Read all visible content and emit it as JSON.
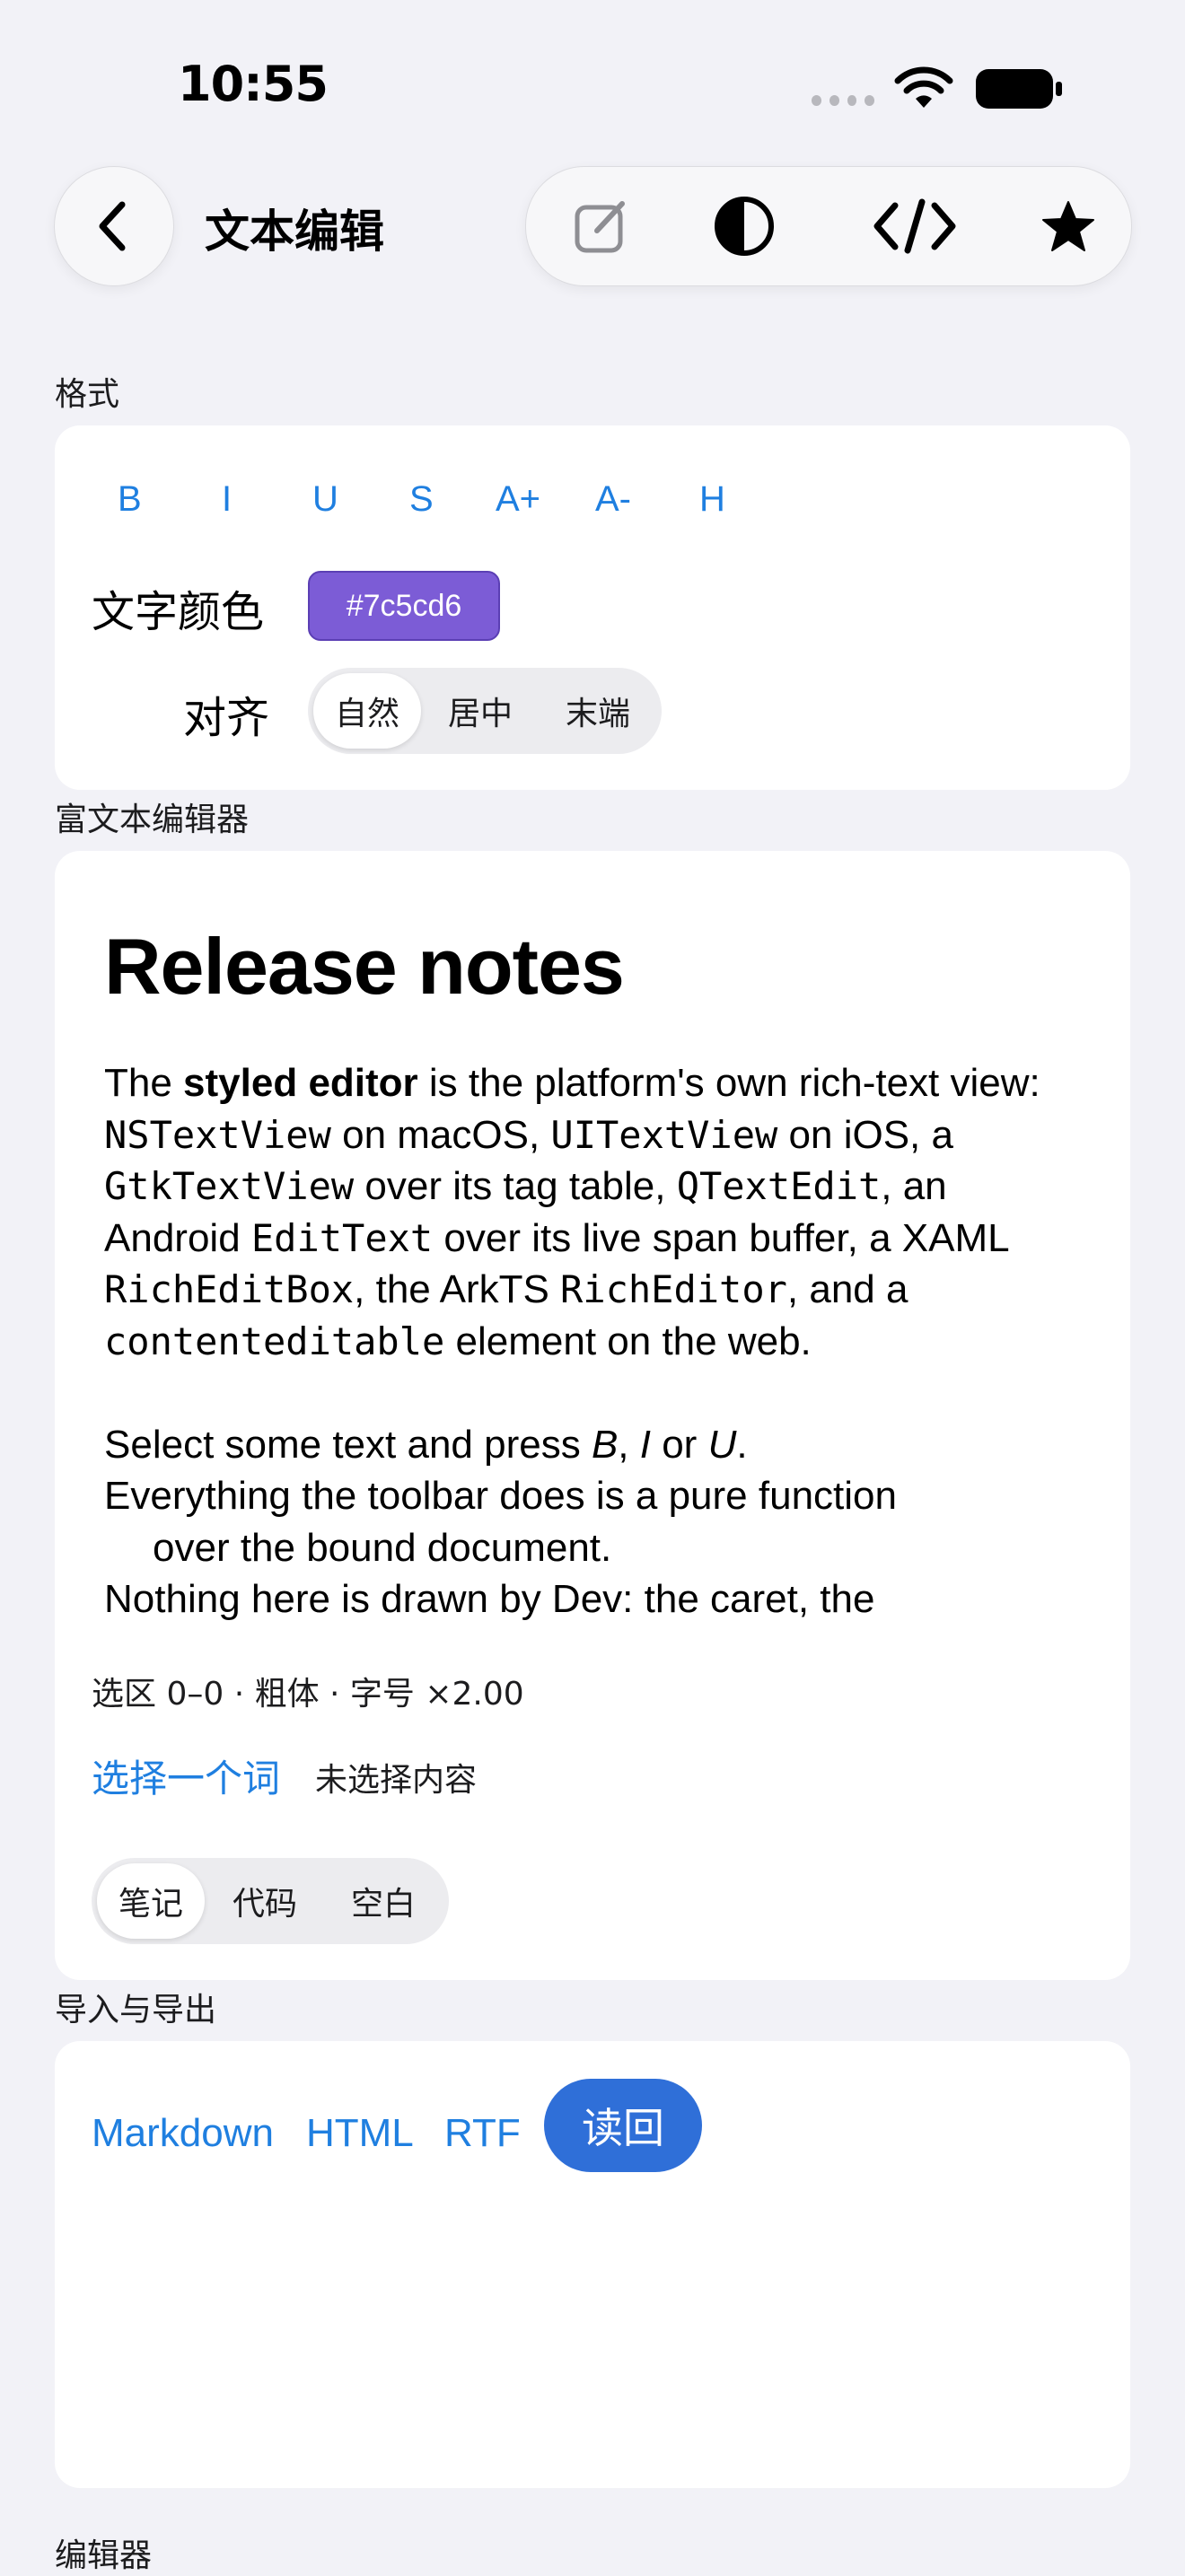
{
  "status_bar": {
    "time": "10:55"
  },
  "nav": {
    "title": "文本编辑"
  },
  "toolbar": {
    "icons": [
      "compose-icon",
      "contrast-icon",
      "code-icon",
      "star-icon"
    ]
  },
  "format_section": {
    "label": "格式",
    "buttons": [
      "B",
      "I",
      "U",
      "S",
      "A+",
      "A-",
      "H"
    ],
    "text_color_label": "文字颜色",
    "text_color_value": "#7c5cd6",
    "align_label": "对齐",
    "align_options": [
      "自然",
      "居中",
      "末端"
    ],
    "align_selected": "自然"
  },
  "rich_editor_section": {
    "label": "富文本编辑器",
    "heading": "Release notes",
    "p1_a": "The ",
    "p1_bold": "styled editor",
    "p1_b": " is the platform's own rich-text view: ",
    "code_nstextview": "NSTextView",
    "p1_c": " on macOS, ",
    "code_uitextview": "UITextView",
    "p1_d": " on iOS, a ",
    "code_gtktextview": "GtkTextView",
    "p1_e": " over its tag table, ",
    "code_qtextedit": "QTextEdit",
    "p1_f": ", an Android ",
    "code_edittext": "EditText",
    "p1_g": " over its live span buffer, a XAML ",
    "code_richeditbox": "RichEditBox",
    "p1_h": ", the ArkTS ",
    "code_richeditor": "RichEditor",
    "p1_i": ", and a ",
    "code_contenteditable": "contenteditable",
    "p1_j": " element on the web.",
    "p2_a": "Select some text and press ",
    "p2_b_italic": "B",
    "p2_c": ", ",
    "p2_i_italic": "I",
    "p2_d": " or ",
    "p2_u_italic": "U",
    "p2_e": ".",
    "p3_a": "Everything the toolbar does is a pure function",
    "p3_b": "over the bound document.",
    "p4": "Nothing here is drawn by Dev: the caret, the",
    "selection_info": "选区 0–0 · 粗体 · 字号 ×2.00",
    "select_word_link": "选择一个词",
    "no_selection": "未选择内容",
    "mode_options": [
      "笔记",
      "代码",
      "空白"
    ],
    "mode_selected": "笔记"
  },
  "import_export_section": {
    "label": "导入与导出",
    "links": [
      "Markdown",
      "HTML",
      "RTF"
    ],
    "readback_label": "读回"
  },
  "editor_section": {
    "label": "编辑器"
  }
}
